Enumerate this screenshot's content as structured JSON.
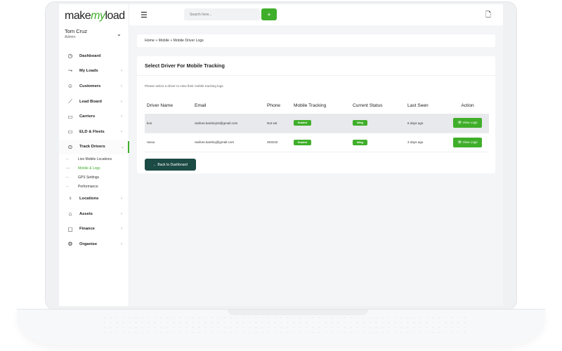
{
  "brand": {
    "logo_left": "make",
    "logo_mid": "my",
    "logo_right": "load",
    "accent": "#3fae2a",
    "dark_button": "#1c4a44"
  },
  "user": {
    "name": "Tom Cruz",
    "role": "Admin"
  },
  "topbar": {
    "search_placeholder": "Search here...",
    "add_label": "+",
    "notification_count": "0"
  },
  "sidebar": {
    "items": [
      {
        "label": "Dashboard",
        "icon": "dashboard-icon",
        "glyph": "◷",
        "has_arrow": false
      },
      {
        "label": "My Loads",
        "icon": "truck-route-icon",
        "glyph": "⤳",
        "has_arrow": true
      },
      {
        "label": "Customers",
        "icon": "add-user-icon",
        "glyph": "☺",
        "has_arrow": true
      },
      {
        "label": "Lead Board",
        "icon": "chart-line-icon",
        "glyph": "⟋",
        "has_arrow": true
      },
      {
        "label": "Carriers",
        "icon": "truck-icon",
        "glyph": "▭",
        "has_arrow": true
      },
      {
        "label": "ELD & Fleets",
        "icon": "fleet-icon",
        "glyph": "▭",
        "has_arrow": true
      },
      {
        "label": "Track Drivers",
        "icon": "pin-icon",
        "glyph": "⊙",
        "has_arrow": true,
        "active": true
      },
      {
        "label": "Locations",
        "icon": "location-icon",
        "glyph": "♀",
        "has_arrow": true
      },
      {
        "label": "Assets",
        "icon": "bag-icon",
        "glyph": "⌂",
        "has_arrow": true
      },
      {
        "label": "Finance",
        "icon": "finance-icon",
        "glyph": "▢",
        "has_arrow": true
      },
      {
        "label": "Organise",
        "icon": "settings-icon",
        "glyph": "⚙",
        "has_arrow": true
      }
    ],
    "subitems": [
      "Live Mobile Locations",
      "Mobile & Logs",
      "GPS Settings",
      "Performance"
    ]
  },
  "breadcrumb": "Home » Mobile » Mobile Driver Logs",
  "card": {
    "title": "Select Driver For Mobile Tracking",
    "description": "Please select a driver to view their mobile tracking logs.",
    "columns": [
      "Driver Name",
      "Email",
      "Phone",
      "Mobile Tracking",
      "Current Status",
      "Last Seen",
      "Action"
    ],
    "rows": [
      {
        "name": "kos",
        "email": "ravikos.kamboj15@gmail.com",
        "phone": "Not set",
        "tracking": "Enabled",
        "status": "Idling",
        "last_seen": "6 days ago",
        "action": "👁 View Logs"
      },
      {
        "name": "ravuu",
        "email": "ravikos.kamboj@gmail.com",
        "phone": "253242",
        "tracking": "Enabled",
        "status": "Idling",
        "last_seen": "3 days ago",
        "action": "👁 View Logs"
      }
    ],
    "back_label": "← Back to Dashboard"
  }
}
